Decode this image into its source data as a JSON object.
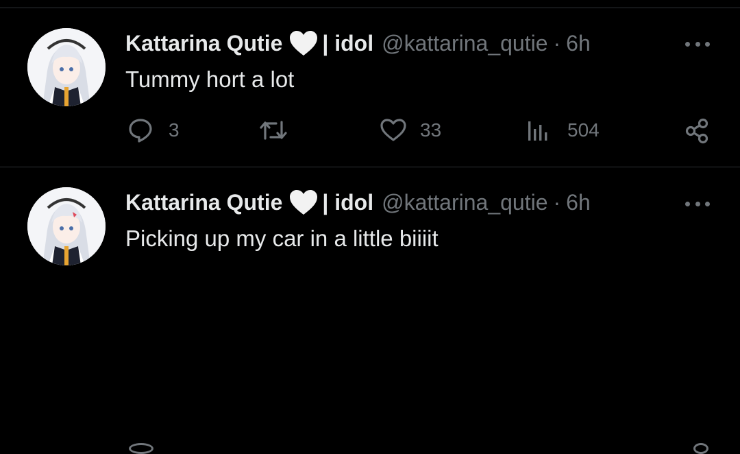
{
  "tweets": [
    {
      "author_name": "Kattarina Qutie",
      "author_suffix": "| idol",
      "handle": "@kattarina_qutie",
      "separator": "·",
      "time": "6h",
      "text": "Tummy hort a lot",
      "replies": "3",
      "likes": "33",
      "views": "504"
    },
    {
      "author_name": "Kattarina Qutie",
      "author_suffix": "| idol",
      "handle": "@kattarina_qutie",
      "separator": "·",
      "time": "6h",
      "text": "Picking up my car in a little biiiit"
    }
  ],
  "icons": {
    "heart": "white-heart-icon",
    "more": "more-options-icon",
    "reply": "reply-icon",
    "retweet": "retweet-icon",
    "like": "like-icon",
    "views": "views-icon",
    "share": "share-icon"
  },
  "colors": {
    "background": "#000000",
    "text": "#e7e9ea",
    "secondary": "#71767b",
    "divider": "#2f3336"
  }
}
